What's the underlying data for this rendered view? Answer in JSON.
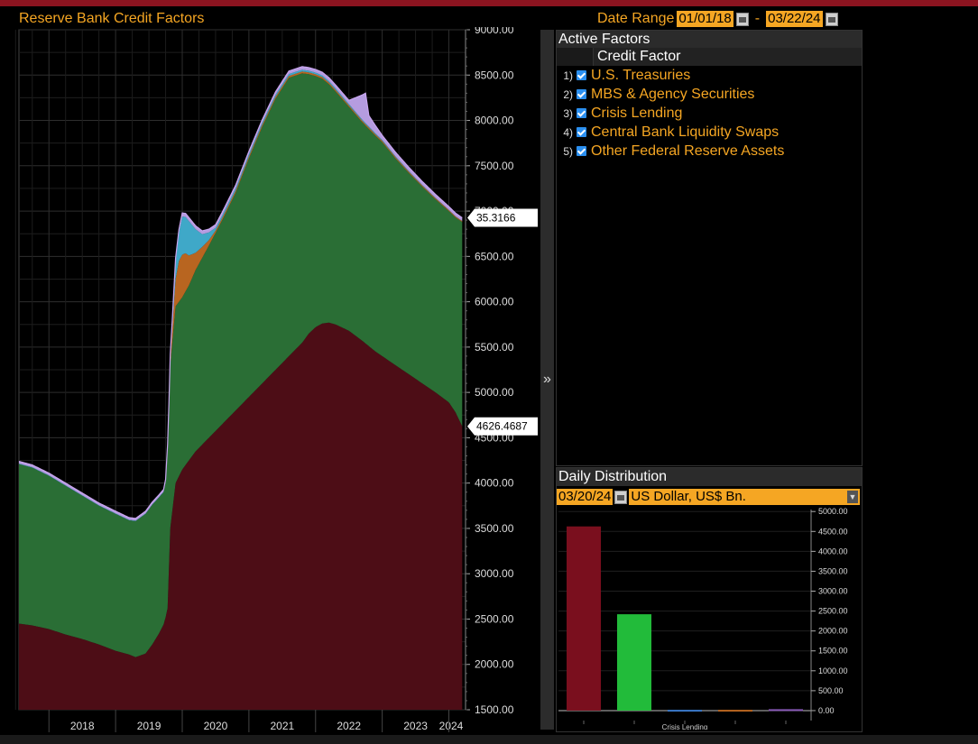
{
  "header": {
    "title": "Reserve Bank Credit Factors"
  },
  "date_range": {
    "label": "Date Range",
    "start": "01/01/18",
    "separator": "-",
    "end": "03/22/24"
  },
  "active_factors": {
    "title": "Active Factors",
    "column_header": "Credit Factor",
    "items": [
      {
        "num": "1)",
        "label": "U.S. Treasuries",
        "checked": true
      },
      {
        "num": "2)",
        "label": "MBS & Agency Securities",
        "checked": true
      },
      {
        "num": "3)",
        "label": "Crisis Lending",
        "checked": true
      },
      {
        "num": "4)",
        "label": "Central Bank Liquidity Swaps",
        "checked": true
      },
      {
        "num": "5)",
        "label": "Other Federal Reserve Assets",
        "checked": true
      }
    ]
  },
  "daily_distribution": {
    "title": "Daily Distribution",
    "date": "03/20/24",
    "currency": "US Dollar, US$ Bn.",
    "x_label": "Crisis Lending"
  },
  "chart_data": [
    {
      "type": "area",
      "title": "Reserve Bank Credit Factors",
      "x_ticks": [
        "2018",
        "2019",
        "2020",
        "2021",
        "2022",
        "2023",
        "2024"
      ],
      "y_ticks": [
        "9000.00",
        "8500.00",
        "8000.00",
        "7500.00",
        "7000.00",
        "6500.00",
        "6000.00",
        "5500.00",
        "5000.00",
        "4500.00",
        "4000.00",
        "3500.00",
        "3000.00",
        "2500.00",
        "2000.00",
        "1500.00"
      ],
      "ylim": [
        1500,
        9000
      ],
      "xlim": [
        2017.55,
        2024.25
      ],
      "grid": true,
      "last_value_labels": [
        "35.3166",
        "4626.4687"
      ],
      "series": [
        {
          "name": "U.S. Treasuries",
          "color": "#4d0d16",
          "x": [
            2017.55,
            2017.75,
            2018.0,
            2018.25,
            2018.5,
            2018.75,
            2019.0,
            2019.2,
            2019.3,
            2019.45,
            2019.55,
            2019.65,
            2019.72,
            2019.75,
            2019.78,
            2019.82,
            2019.9,
            2020.0,
            2020.1,
            2020.2,
            2020.4,
            2020.6,
            2020.8,
            2021.0,
            2021.2,
            2021.4,
            2021.6,
            2021.8,
            2021.9,
            2022.0,
            2022.1,
            2022.2,
            2022.3,
            2022.5,
            2022.7,
            2022.9,
            2023.0,
            2023.2,
            2023.4,
            2023.6,
            2023.8,
            2024.0,
            2024.1,
            2024.2
          ],
          "values": [
            2450,
            2430,
            2390,
            2330,
            2280,
            2220,
            2150,
            2110,
            2080,
            2120,
            2220,
            2340,
            2440,
            2520,
            2620,
            3500,
            4000,
            4150,
            4250,
            4350,
            4500,
            4650,
            4800,
            4950,
            5100,
            5250,
            5400,
            5550,
            5650,
            5720,
            5760,
            5770,
            5750,
            5680,
            5570,
            5450,
            5400,
            5300,
            5200,
            5100,
            5000,
            4890,
            4780,
            4626
          ]
        },
        {
          "name": "MBS & Agency Securities",
          "color": "#2a6e35",
          "x": [
            2017.55,
            2017.75,
            2018.0,
            2018.25,
            2018.5,
            2018.75,
            2019.0,
            2019.2,
            2019.3,
            2019.45,
            2019.55,
            2019.65,
            2019.72,
            2019.75,
            2019.78,
            2019.82,
            2019.9,
            2020.0,
            2020.1,
            2020.2,
            2020.4,
            2020.6,
            2020.8,
            2021.0,
            2021.2,
            2021.4,
            2021.6,
            2021.8,
            2021.9,
            2022.0,
            2022.1,
            2022.2,
            2022.3,
            2022.5,
            2022.7,
            2022.9,
            2023.0,
            2023.2,
            2023.4,
            2023.6,
            2023.8,
            2024.0,
            2024.1,
            2024.2
          ],
          "values": [
            4210,
            4170,
            4080,
            3970,
            3860,
            3750,
            3660,
            3590,
            3580,
            3660,
            3760,
            3840,
            3900,
            4010,
            4400,
            5300,
            5950,
            6050,
            6180,
            6350,
            6620,
            6900,
            7200,
            7580,
            7930,
            8240,
            8470,
            8520,
            8510,
            8490,
            8460,
            8400,
            8320,
            8150,
            7980,
            7830,
            7760,
            7580,
            7420,
            7270,
            7130,
            7000,
            6930,
            6880
          ]
        },
        {
          "name": "Crisis Lending",
          "color": "#b86520",
          "x": [
            2017.55,
            2019.8,
            2019.85,
            2019.9,
            2019.95,
            2020.0,
            2020.05,
            2020.1,
            2020.15,
            2020.2,
            2020.3,
            2020.4,
            2020.5,
            2024.2
          ],
          "values": [
            0,
            0,
            150,
            300,
            450,
            470,
            420,
            330,
            260,
            190,
            120,
            60,
            25,
            10
          ]
        },
        {
          "name": "Central Bank Liquidity Swaps",
          "color": "#3fa8c8",
          "x": [
            2017.55,
            2019.8,
            2019.85,
            2019.9,
            2020.0,
            2020.1,
            2020.2,
            2020.3,
            2020.5,
            2024.2
          ],
          "values": [
            5,
            5,
            80,
            200,
            420,
            380,
            260,
            140,
            30,
            1
          ]
        },
        {
          "name": "Other Federal Reserve Assets",
          "color": "#b59ce0",
          "x": [
            2017.55,
            2018.5,
            2019.5,
            2019.8,
            2020.0,
            2020.5,
            2021.0,
            2022.0,
            2022.5,
            2022.75,
            2022.8,
            2023.0,
            2023.5,
            2024.2
          ],
          "values": [
            25,
            25,
            25,
            25,
            40,
            35,
            30,
            35,
            40,
            330,
            120,
            50,
            40,
            35
          ]
        }
      ]
    },
    {
      "type": "bar",
      "categories": [
        "U.S. Treasuries",
        "MBS & Agency Securities",
        "Crisis Lending",
        "Central Bank Liquidity Swaps",
        "Other Federal Reserve Assets"
      ],
      "values": [
        4626,
        2420,
        10,
        1,
        35
      ],
      "colors": [
        "#7a0f1e",
        "#22bb3a",
        "#3a78c8",
        "#b86520",
        "#8a5ab8"
      ],
      "x_label": "Crisis Lending",
      "y_ticks": [
        "5000.00",
        "4500.00",
        "4000.00",
        "3500.00",
        "3000.00",
        "2500.00",
        "2000.00",
        "1500.00",
        "1000.00",
        "500.00",
        "0.00"
      ],
      "ylim": [
        -250,
        5050
      ]
    }
  ]
}
